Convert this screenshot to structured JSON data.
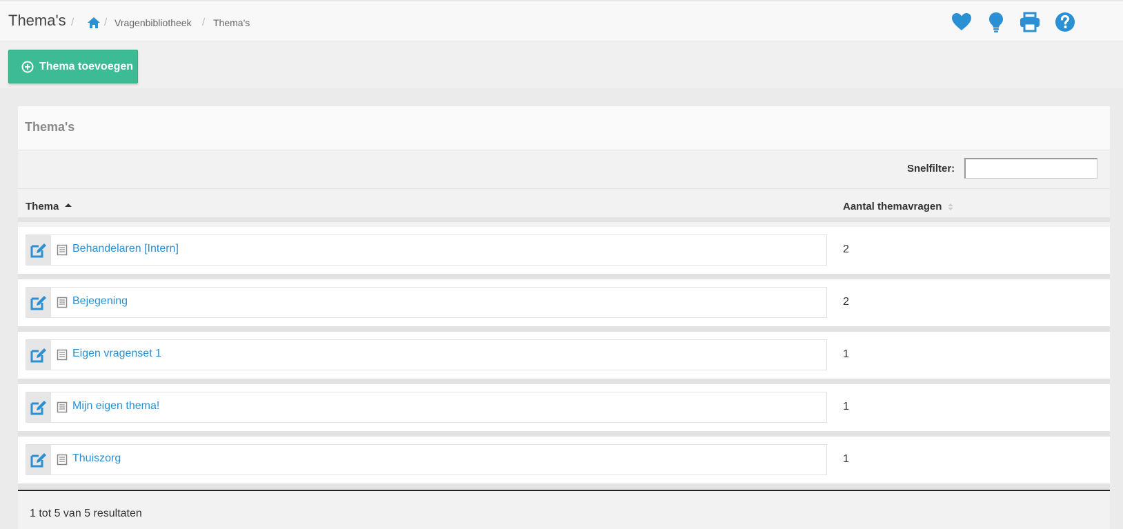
{
  "header": {
    "title": "Thema's",
    "breadcrumb": [
      "Vragenbibliotheek",
      "Thema's"
    ]
  },
  "icons": [
    "home-icon",
    "heart-icon",
    "lightbulb-icon",
    "print-icon",
    "help-icon",
    "edit-icon",
    "book-icon",
    "plus-circle-icon"
  ],
  "colors": {
    "accent": "#2a8fd3",
    "button": "#3dbb95"
  },
  "toolbar": {
    "add_label": "Thema toevoegen"
  },
  "panel": {
    "title": "Thema's",
    "filter_label": "Snelfilter:",
    "filter_value": "",
    "columns": [
      "Thema",
      "Aantal themavragen"
    ],
    "rows": [
      {
        "name": "Behandelaren [Intern]",
        "count": "2"
      },
      {
        "name": "Bejegening",
        "count": "2"
      },
      {
        "name": "Eigen vragenset 1",
        "count": "1"
      },
      {
        "name": "Mijn eigen thema!",
        "count": "1"
      },
      {
        "name": "Thuiszorg",
        "count": "1"
      }
    ],
    "footer": "1 tot 5 van 5 resultaten"
  }
}
